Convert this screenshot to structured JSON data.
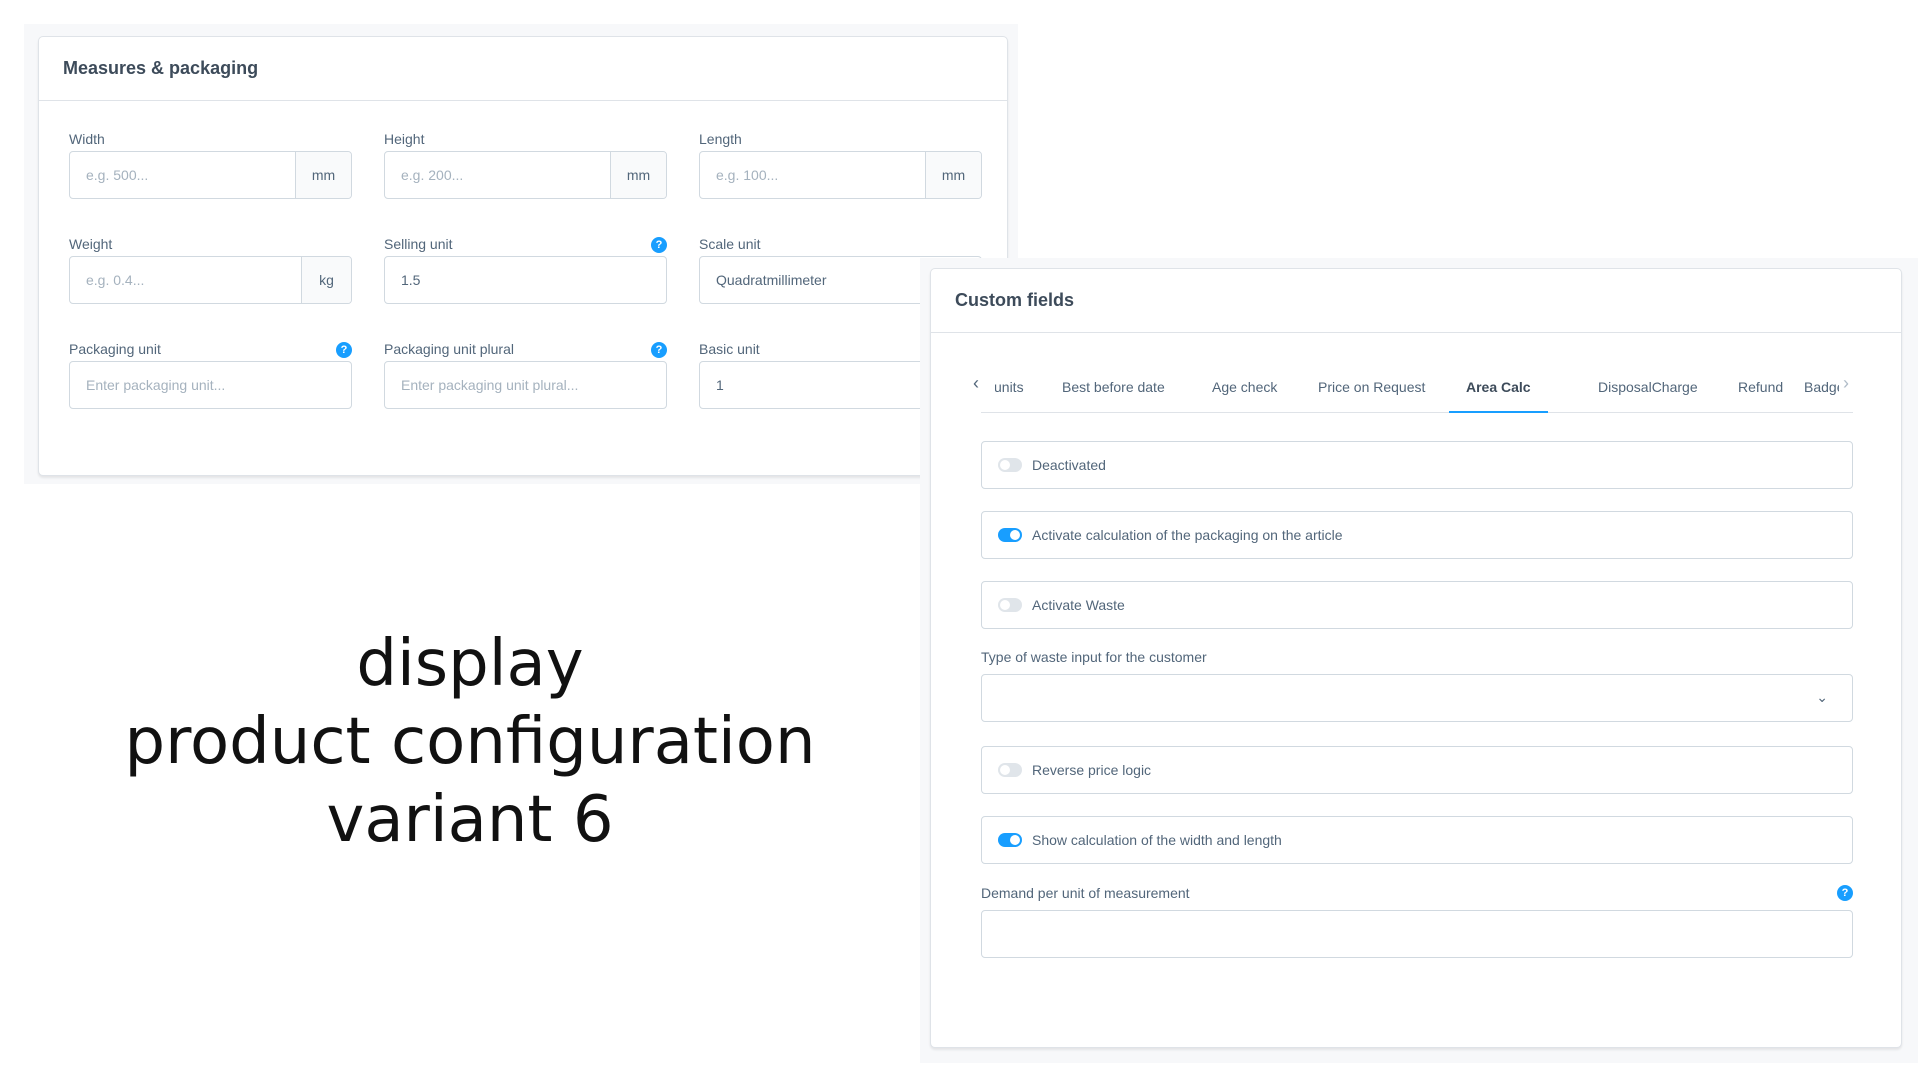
{
  "measures": {
    "title": "Measures & packaging",
    "width": {
      "label": "Width",
      "placeholder": "e.g. 500...",
      "unit": "mm"
    },
    "height": {
      "label": "Height",
      "placeholder": "e.g. 200...",
      "unit": "mm"
    },
    "length": {
      "label": "Length",
      "placeholder": "e.g. 100...",
      "unit": "mm"
    },
    "weight": {
      "label": "Weight",
      "placeholder": "e.g. 0.4...",
      "unit": "kg"
    },
    "selling_unit": {
      "label": "Selling unit",
      "value": "1.5"
    },
    "scale_unit": {
      "label": "Scale unit",
      "value": "Quadratmillimeter"
    },
    "packaging_unit": {
      "label": "Packaging unit",
      "placeholder": "Enter packaging unit..."
    },
    "packaging_unit_plural": {
      "label": "Packaging unit plural",
      "placeholder": "Enter packaging unit plural..."
    },
    "basic_unit": {
      "label": "Basic unit",
      "value": "1"
    },
    "help_glyph": "?"
  },
  "caption": {
    "line1": "display",
    "line2": "product configuration",
    "line3": "variant 6"
  },
  "custom_fields": {
    "title": "Custom fields",
    "tabs": [
      {
        "label": "j units",
        "active": false
      },
      {
        "label": "Best before date",
        "active": false
      },
      {
        "label": "Age check",
        "active": false
      },
      {
        "label": "Price on Request",
        "active": false
      },
      {
        "label": "Area Calc",
        "active": true
      },
      {
        "label": "DisposalCharge",
        "active": false
      },
      {
        "label": "Refund",
        "active": false
      },
      {
        "label": "Badges",
        "active": false
      }
    ],
    "arrow_left": "‹",
    "arrow_right": "›",
    "switches": {
      "deactivated": {
        "label": "Deactivated",
        "on": false
      },
      "activate_calculation": {
        "label": "Activate calculation of the packaging on the article",
        "on": true
      },
      "activate_waste": {
        "label": "Activate Waste",
        "on": false
      },
      "reverse_price": {
        "label": "Reverse price logic",
        "on": false
      },
      "show_calculation": {
        "label": "Show calculation of the width and length",
        "on": true
      }
    },
    "waste_type": {
      "label": "Type of waste input for the customer",
      "value": ""
    },
    "demand": {
      "label": "Demand per unit of measurement",
      "value": ""
    },
    "chevron": "⌄"
  },
  "colors": {
    "accent": "#189eff",
    "text": "#52667a",
    "border": "#d1d9e0",
    "title": "#3d4b5a"
  },
  "icons": {
    "help": "help-icon",
    "chevron": "chevron-down-icon",
    "arrow_left": "arrow-left-icon",
    "arrow_right": "arrow-right-icon"
  }
}
